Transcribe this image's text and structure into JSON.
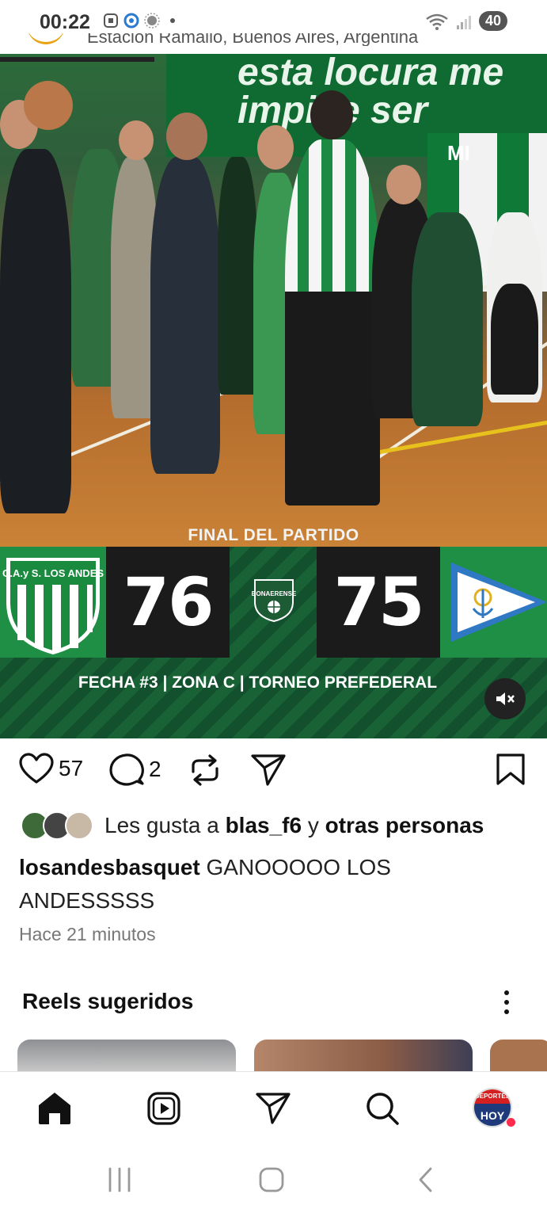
{
  "status_bar": {
    "time": "00:22",
    "battery": "40"
  },
  "post": {
    "location_partial": "Estación Ramallo, Buenos Aires, Argentina",
    "photo_banner_text": "esta locura me impide ser",
    "photo_flag_text": "MI",
    "overlay_label": "FINAL DEL PARTIDO",
    "scoreboard": {
      "home_team_short": "C.A.y S. LOS ANDES",
      "home_score": "76",
      "away_score": "75",
      "league_logo_text": "BONAERENSE",
      "fecha_line": "FECHA #3 | ZONA C | TORNEO PREFEDERAL"
    },
    "actions": {
      "likes_count": "57",
      "comments_count": "2"
    },
    "liked_by": {
      "prefix": "Les gusta a",
      "user": "blas_f6",
      "connector": "y",
      "others": "otras personas"
    },
    "caption": {
      "username": "losandesbasquet",
      "text": "GANOOOOO LOS ANDESSSSS"
    },
    "timestamp": "Hace 21 minutos"
  },
  "reels": {
    "title": "Reels sugeridos"
  },
  "bottom_nav": {
    "profile_top": "DEPORTES",
    "profile_bottom": "HOY"
  },
  "colors": {
    "team_green": "#1f8f45",
    "score_bg": "#1b1b1b",
    "notification": "#ff2a4c"
  }
}
